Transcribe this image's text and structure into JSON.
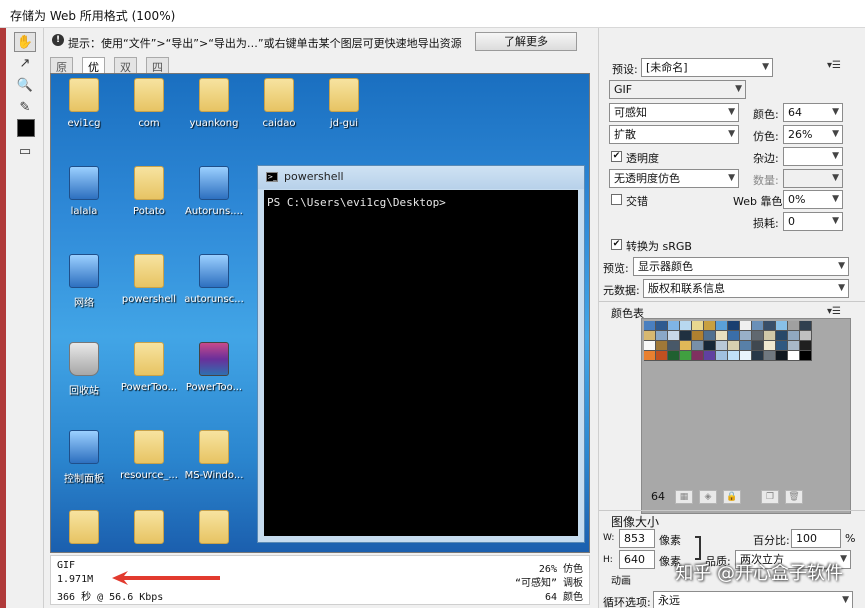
{
  "window": {
    "title": "存储为 Web 所用格式 (100%)"
  },
  "hint": {
    "icon": "info-icon",
    "text": "提示：使用“文件”>“导出”>“导出为…”或右键单击某个图层可更快速地导出资源",
    "learn_more": "了解更多"
  },
  "tools": [
    "hand-tool-icon",
    "slice-select-icon",
    "zoom-icon",
    "eyedropper-icon",
    "toggle-slices-icon"
  ],
  "tabs": [
    {
      "label": "原稿"
    },
    {
      "label": "优化"
    },
    {
      "label": "双联"
    },
    {
      "label": "四联"
    }
  ],
  "desktop": {
    "icons": [
      {
        "label": "evi1cg",
        "type": "folder"
      },
      {
        "label": "com",
        "type": "folder"
      },
      {
        "label": "yuankong",
        "type": "folder"
      },
      {
        "label": "caidao",
        "type": "folder"
      },
      {
        "label": "jd-gui",
        "type": "folder"
      },
      {
        "label": "lalala",
        "type": "sys"
      },
      {
        "label": "Potato",
        "type": "folder"
      },
      {
        "label": "Autoruns....",
        "type": "sys"
      },
      {
        "label": "网络",
        "type": "sys"
      },
      {
        "label": "powershell",
        "type": "folder"
      },
      {
        "label": "autorunsc...",
        "type": "sys"
      },
      {
        "label": "回收站",
        "type": "bin"
      },
      {
        "label": "PowerToo...",
        "type": "folder"
      },
      {
        "label": "PowerToo...",
        "type": "rar"
      },
      {
        "label": "控制面板",
        "type": "sys"
      },
      {
        "label": "resource_...",
        "type": "folder"
      },
      {
        "label": "MS-Windo...",
        "type": "folder"
      },
      {
        "label": "",
        "type": "folder"
      },
      {
        "label": "",
        "type": "folder"
      },
      {
        "label": "",
        "type": "folder"
      }
    ]
  },
  "powershell": {
    "title": "powershell",
    "prompt": "PS C:\\Users\\evi1cg\\Desktop>"
  },
  "status": {
    "format": "GIF",
    "size": "1.971M",
    "time": "366 秒 @ 56.6 Kbps",
    "dither": "26% 仿色",
    "palette": "“可感知”  调板",
    "colors": "64  颜色"
  },
  "settings": {
    "preset_label": "预设:",
    "preset_value": "[未命名]",
    "format": "GIF",
    "reduction": "可感知",
    "colors_label": "颜色:",
    "colors_value": "64",
    "dither_algo": "扩散",
    "dither_label": "仿色:",
    "dither_value": "26%",
    "transparency_label": "透明度",
    "transparency_checked": true,
    "matte_label": "杂边:",
    "trans_dither": "无透明度仿色",
    "amount_label": "数量:",
    "interlaced_label": "交错",
    "interlaced_checked": false,
    "websnap_label": "Web 靠色:",
    "websnap_value": "0%",
    "lossy_label": "损耗:",
    "lossy_value": "0",
    "srgb_label": "转换为 sRGB",
    "srgb_checked": true,
    "preview_label": "预览:",
    "preview_value": "显示器颜色",
    "metadata_label": "元数据:",
    "metadata_value": "版权和联系信息"
  },
  "color_table": {
    "title": "颜色表",
    "count": "64",
    "swatches": [
      "#4a7fbf",
      "#2f5a8f",
      "#7fb4e6",
      "#b8d8f0",
      "#e8d890",
      "#c8a040",
      "#5aa0d8",
      "#1a3f70",
      "#f0f0f0",
      "#6a90b8",
      "#384f6a",
      "#88c0e8",
      "#a0a0a0",
      "#304050",
      "#d8b870",
      "#8aa8c8",
      "#c8d8e8",
      "#203040",
      "#b08030",
      "#507090",
      "#e8e0c0",
      "#3a6ea8",
      "#98b0c8",
      "#606870",
      "#d0c8a8",
      "#284868",
      "#90a8c0",
      "#c0c0c0",
      "#f8f8f8",
      "#a07838",
      "#485868",
      "#e0b858",
      "#7890a8",
      "#182838",
      "#b8c8d8",
      "#d8d0b0",
      "#5880a8",
      "#404850",
      "#f0e8d0",
      "#305880",
      "#a8b8c8",
      "#202020",
      "#e88030",
      "#c05020",
      "#206030",
      "#40a040",
      "#803060",
      "#6040a0",
      "#a0c0e0",
      "#c0e0f8",
      "#e8f4fc",
      "#283848",
      "#707880",
      "#101820",
      "#ffffff",
      "#000000"
    ],
    "footer_icons": [
      "map-to-transparent-icon",
      "web-shift-icon",
      "lock-color-icon",
      "new-color-icon",
      "delete-color-icon"
    ]
  },
  "image_size": {
    "title": "图像大小",
    "w_label": "W:",
    "w_value": "853",
    "w_unit": "像素",
    "h_label": "H:",
    "h_value": "640",
    "h_unit": "像素",
    "percent_label": "百分比:",
    "percent_value": "100",
    "percent_unit": "%",
    "quality_label": "品质:",
    "quality_value": "两次立方"
  },
  "animation": {
    "title": "动画",
    "loop_label": "循环选项:",
    "loop_value": "永远"
  },
  "watermark": "知乎 @开心盒子软件"
}
